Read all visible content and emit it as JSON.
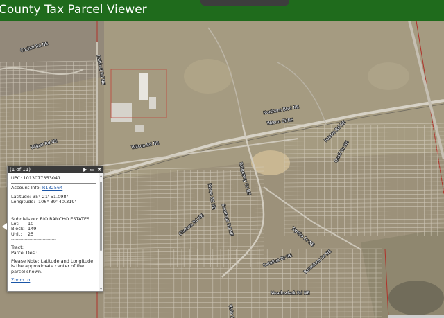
{
  "app": {
    "title": "County Tax Parcel Viewer"
  },
  "map": {
    "street_labels": [
      "Hubbell Rd NE",
      "Cochiti Rd NE",
      "Northern Blvd NE",
      "Wilson Ct NE",
      "Wilson Rd NE",
      "Wilpat Rd NE",
      "Pueblo Rd NE",
      "Quail Dr NE",
      "Ridgeway Dr NE",
      "Kiowa Rd NE",
      "Saratoga Rd NE",
      "Topeka Dr NE",
      "Chelsea Rd NE",
      "Catalina Dr NE",
      "Barcelona Dr NE",
      "Meadowlark Rd NE",
      "Vista Dr NE"
    ]
  },
  "popup": {
    "counter": "(1 of 11)",
    "next_glyph": "▶",
    "maximize_glyph": "▭",
    "close_glyph": "✖",
    "upc_label": "UPC:",
    "upc_value": "1013077353041",
    "account_label": "Account Info:",
    "account_value": "R132564",
    "latitude_label": "Latitude:",
    "latitude_value": "35° 21' 51.098\"",
    "longitude_label": "Longitude:",
    "longitude_value": "-106° 39' 40.319\"",
    "divider_dashes": "------------------------------",
    "subdivision_label": "Subdivision:",
    "subdivision_value": "RIO RANCHO ESTATES",
    "lot_label": "Lot:",
    "lot_value": "10",
    "block_label": "Block:",
    "block_value": "149",
    "unit_label": "Unit:",
    "unit_value": "25",
    "tract_label": "Tract:",
    "parcel_label": "Parcel Des.:",
    "note": "Please Note: Latitude and Longitude is the approximate center of the parcel shown.",
    "zoom_link": "Zoom to"
  }
}
